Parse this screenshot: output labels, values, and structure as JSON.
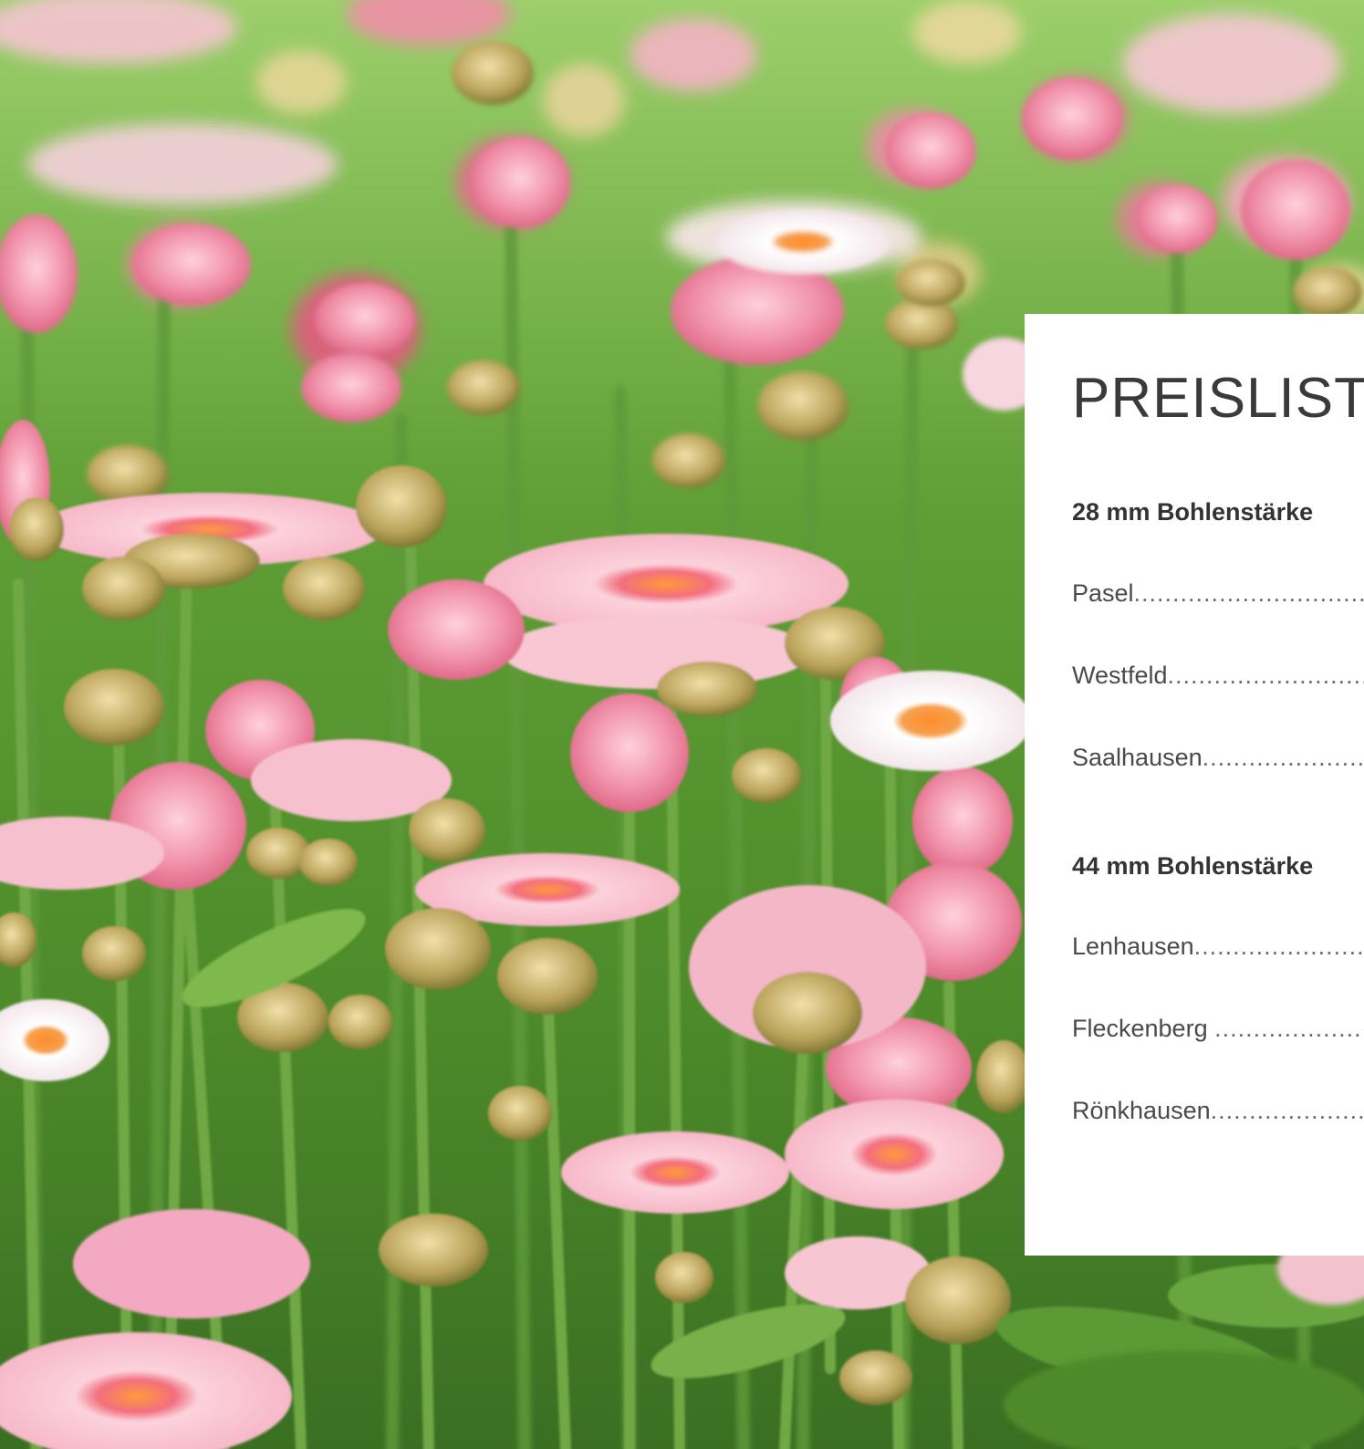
{
  "panel": {
    "title": "PREISLIST",
    "sections": [
      {
        "heading": "28 mm Bohlenstärke",
        "rows": [
          {
            "label": "Pasel"
          },
          {
            "label": "Westfeld"
          },
          {
            "label": "Saalhausen"
          }
        ]
      },
      {
        "heading": "44 mm Bohlenstärke",
        "rows": [
          {
            "label": "Lenhausen"
          },
          {
            "label": "Fleckenberg "
          },
          {
            "label": "Rönkhausen"
          }
        ]
      }
    ]
  },
  "colors": {
    "panel_background": "#ffffff",
    "title_text": "#3a3a3a",
    "heading_text": "#333333",
    "row_text": "#4a4a4a",
    "foliage_green": "#4f8f2f",
    "petal_pink": "#ee8ea5",
    "flower_center_orange": "#f08a2a"
  },
  "background": {
    "subject": "pink-daisy-field-photo"
  }
}
